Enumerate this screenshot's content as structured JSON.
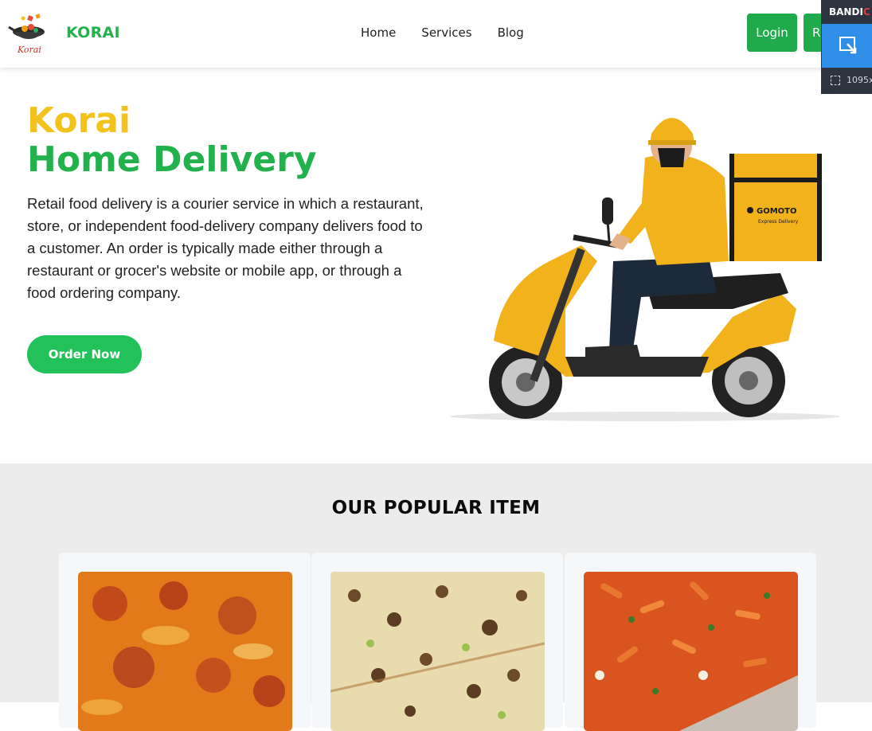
{
  "header": {
    "brand": "KORAI",
    "logo_text": "Korai",
    "nav": [
      "Home",
      "Services",
      "Blog"
    ],
    "login_label": "Login",
    "register_label": "R"
  },
  "overlay": {
    "title_white": "BANDI",
    "title_red": "C",
    "size_text": "1095x"
  },
  "hero": {
    "title_line1": "Korai",
    "title_line2": "Home Delivery",
    "description": "Retail food delivery is a courier service in which a restaurant, store, or independent food-delivery company delivers food to a customer. An order is typically made either through a restaurant or grocer's website or mobile app, or through a food ordering company.",
    "order_button": "Order Now",
    "bag_brand": "GOMOTO",
    "bag_sub": "Express Delivery"
  },
  "popular": {
    "title": "OUR POPULAR ITEM",
    "items": [
      {
        "icon": "pizza-meat-photo"
      },
      {
        "icon": "pizza-mushroom-photo"
      },
      {
        "icon": "pizza-pasta-photo"
      }
    ]
  },
  "colors": {
    "brand_green": "#22b24c",
    "accent_yellow": "#f4c21c",
    "button_green": "#1faa4b"
  }
}
